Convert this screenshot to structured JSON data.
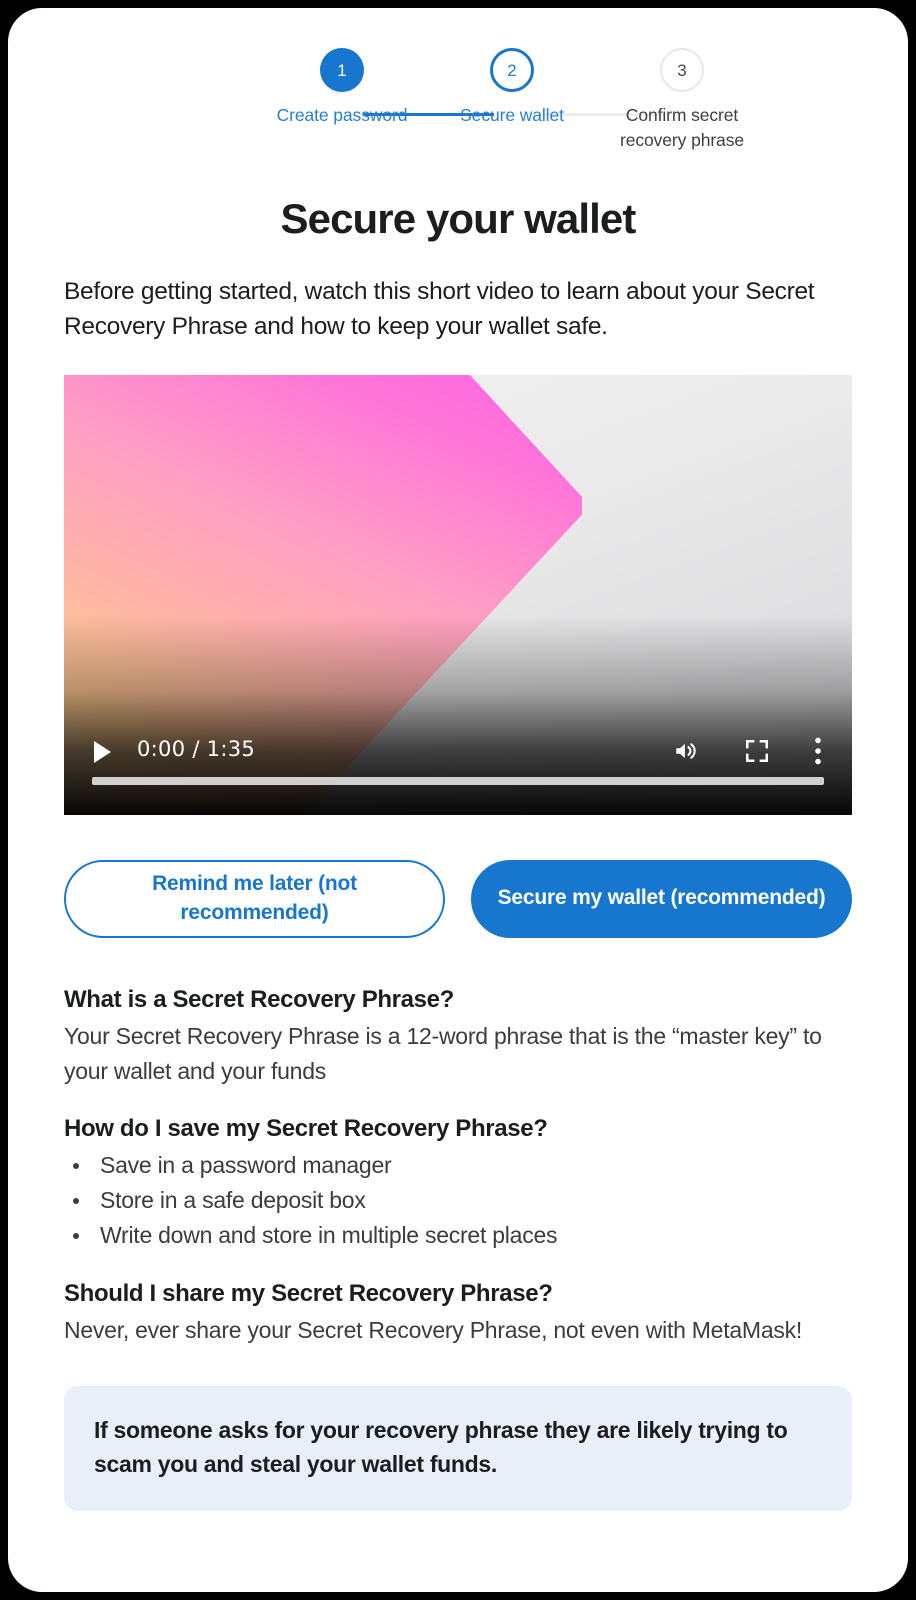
{
  "stepper": {
    "steps": [
      {
        "number": "1",
        "label": "Create password",
        "state": "completed"
      },
      {
        "number": "2",
        "label": "Secure wallet",
        "state": "active"
      },
      {
        "number": "3",
        "label": "Confirm secret recovery phrase",
        "state": "upcoming"
      }
    ]
  },
  "page": {
    "title": "Secure your wallet",
    "subtitle": "Before getting started, watch this short video to learn about your Secret Recovery Phrase and how to keep your wallet safe."
  },
  "video": {
    "current_time": "0:00",
    "duration": "1:35",
    "time_display": "0:00 / 1:35",
    "play_icon": "play-icon",
    "volume_icon": "volume-icon",
    "fullscreen_icon": "fullscreen-icon",
    "more_icon": "more-options-icon",
    "progress_percent": 0
  },
  "actions": {
    "secondary": "Remind me later (not recommended)",
    "primary": "Secure my wallet (recommended)"
  },
  "faq": [
    {
      "question": "What is a Secret Recovery Phrase?",
      "answer": "Your Secret Recovery Phrase is a 12-word phrase that is the “master key” to your wallet and your funds"
    },
    {
      "question": "How do I save my Secret Recovery Phrase?",
      "bullets": [
        "Save in a password manager",
        "Store in a safe deposit box",
        "Write down and store in multiple secret places"
      ]
    },
    {
      "question": "Should I share my Secret Recovery Phrase?",
      "answer": "Never, ever share your Secret Recovery Phrase, not even with MetaMask!"
    }
  ],
  "banner": {
    "text": "If someone asks for your recovery phrase they are likely trying to scam you and steal your wallet funds."
  },
  "colors": {
    "accent": "#1777CF",
    "accent_text": "#2a7fd1",
    "heading": "#1b1d21",
    "body": "#3a3c42",
    "banner_bg": "#e8eff9",
    "idle_border": "#e6e7ea"
  }
}
